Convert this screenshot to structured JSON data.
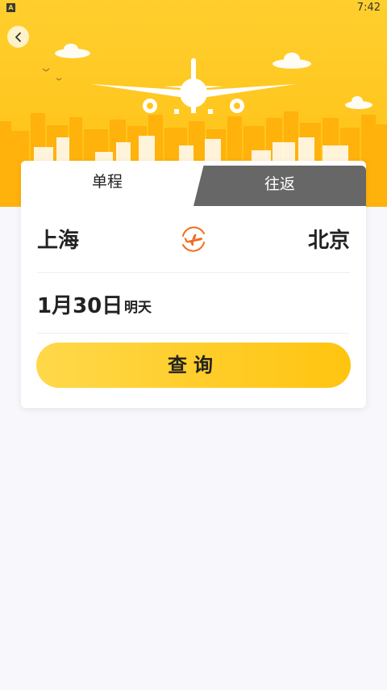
{
  "status_bar": {
    "app_icon_letter": "A",
    "time": "7:42"
  },
  "tabs": {
    "one_way": "单程",
    "round_trip": "往返",
    "active": "one_way"
  },
  "route": {
    "from_city": "上海",
    "to_city": "北京",
    "swap_icon": "plane-swap-icon"
  },
  "date": {
    "main": "1月30日",
    "relative": "明天"
  },
  "search": {
    "label": "查询"
  },
  "colors": {
    "brand_yellow": "#ffc61e",
    "accent_orange": "#f36b1c",
    "text_dark": "#222222"
  }
}
